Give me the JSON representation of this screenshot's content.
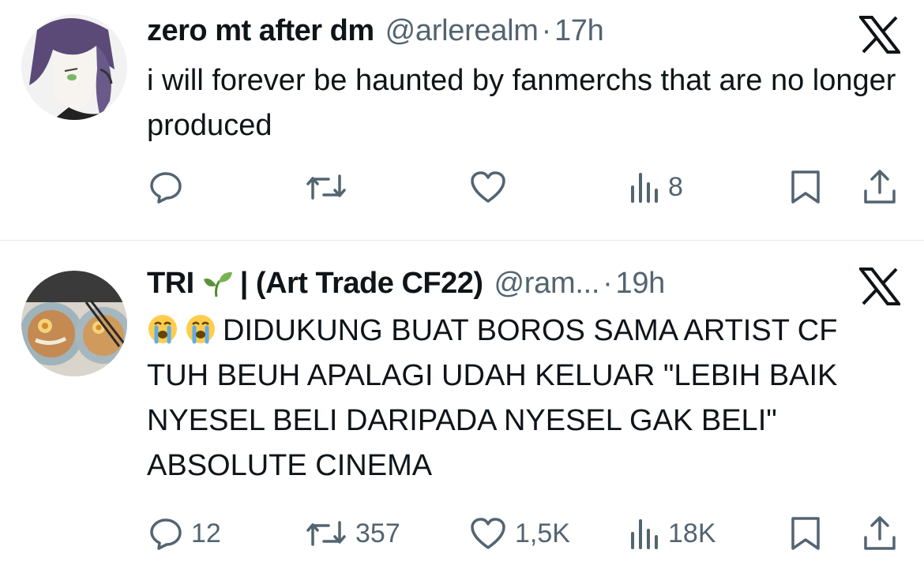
{
  "tweets": [
    {
      "name": "zero mt after dm",
      "handle": "@arlerealm",
      "separator": "·",
      "time": "17h",
      "text": "i will forever be haunted by fanmerchs that are no longer produced",
      "stats": {
        "replies": "",
        "reposts": "",
        "likes": "",
        "views": "8"
      }
    },
    {
      "name_prefix": "TRI",
      "name_suffix": "| (Art Trade CF22)",
      "handle": "@ram...",
      "separator": "·",
      "time": "19h",
      "emoji": [
        "😭",
        "😭"
      ],
      "text": "DIDUKUNG BUAT BOROS SAMA ARTIST CF TUH BEUH APALAGI UDAH KELUAR \"LEBIH BAIK NYESEL BELI DARIPADA NYESEL GAK BELI\" ABSOLUTE CINEMA",
      "stats": {
        "replies": "12",
        "reposts": "357",
        "likes": "1,5K",
        "views": "18K"
      }
    }
  ],
  "icons": [
    "reply-icon",
    "repost-icon",
    "like-icon",
    "views-icon",
    "bookmark-icon",
    "share-icon",
    "x-logo-icon",
    "sprout-emoji",
    "crying-face-emoji"
  ],
  "colors": {
    "text": "#0f1419",
    "secondary": "#536471",
    "divider": "#e6e9ec"
  }
}
